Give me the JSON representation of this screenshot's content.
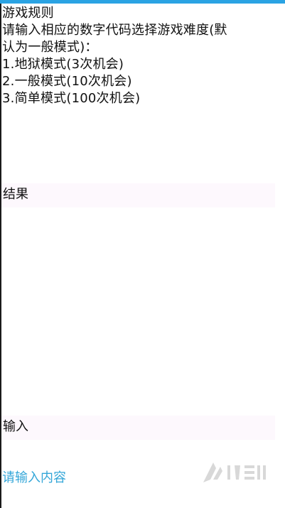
{
  "rules": {
    "title": "游戏规则",
    "desc_line1": "请输入相应的数字代码选择游戏难度(默",
    "desc_line2": "认为一般模式)：",
    "options": [
      "1.地狱模式(3次机会)",
      "2.一般模式(10次机会)",
      "3.简单模式(100次机会)"
    ]
  },
  "result": {
    "label": "结果"
  },
  "input": {
    "label": "输入",
    "placeholder": "请输入内容"
  },
  "colors": {
    "accent": "#2aa3e3",
    "placeholder": "#33a6d8",
    "section_bg": "#fdf8fd"
  },
  "watermark": {
    "icon": "game-site-logo-icon"
  }
}
